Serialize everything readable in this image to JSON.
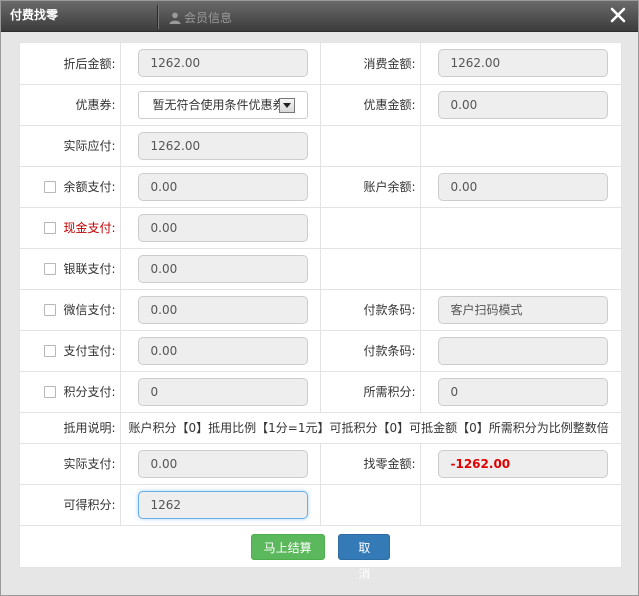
{
  "window": {
    "title": "付费找零",
    "tab_member": "会员信息",
    "close_label": "关闭"
  },
  "form": {
    "discounted_amount": {
      "label": "折后金额:",
      "value": "1262.00"
    },
    "consumption_amount": {
      "label": "消费金额:",
      "value": "1262.00"
    },
    "coupon": {
      "label": "优惠券:",
      "selected": "暂无符合使用条件优惠券"
    },
    "coupon_amount": {
      "label": "优惠金额:",
      "value": "0.00"
    },
    "payable": {
      "label": "实际应付:",
      "value": "1262.00"
    },
    "balance_pay": {
      "label": "余额支付:",
      "value": "0.00",
      "checked": false
    },
    "account_balance": {
      "label": "账户余额:",
      "value": "0.00"
    },
    "cash_pay": {
      "label": "现金支付:",
      "value": "0.00",
      "checked": false
    },
    "unionpay_pay": {
      "label": "银联支付:",
      "value": "0.00",
      "checked": false
    },
    "wechat_pay": {
      "label": "微信支付:",
      "value": "0.00",
      "checked": false
    },
    "wechat_barcode": {
      "label": "付款条码:",
      "value": "客户扫码模式"
    },
    "alipay_pay": {
      "label": "支付宝付:",
      "value": "0.00",
      "checked": false
    },
    "alipay_barcode": {
      "label": "付款条码:",
      "value": ""
    },
    "points_pay": {
      "label": "积分支付:",
      "value": "0",
      "checked": false
    },
    "points_required": {
      "label": "所需积分:",
      "value": "0"
    },
    "deduction": {
      "label": "抵用说明:",
      "text": "账户积分【0】抵用比例【1分=1元】可抵积分【0】可抵金额【0】所需积分为比例整数倍"
    },
    "actual_paid": {
      "label": "实际支付:",
      "value": "0.00"
    },
    "change_amount": {
      "label": "找零金额:",
      "value": "-1262.00"
    },
    "earned_points": {
      "label": "可得积分:",
      "value": "1262"
    }
  },
  "buttons": {
    "settle": "马上结算",
    "cancel": "取 消"
  },
  "colors": {
    "accent_red": "#c00000",
    "settle_green": "#5cb85c",
    "cancel_blue": "#337ab7",
    "titlebar": "#4a4a4a"
  }
}
